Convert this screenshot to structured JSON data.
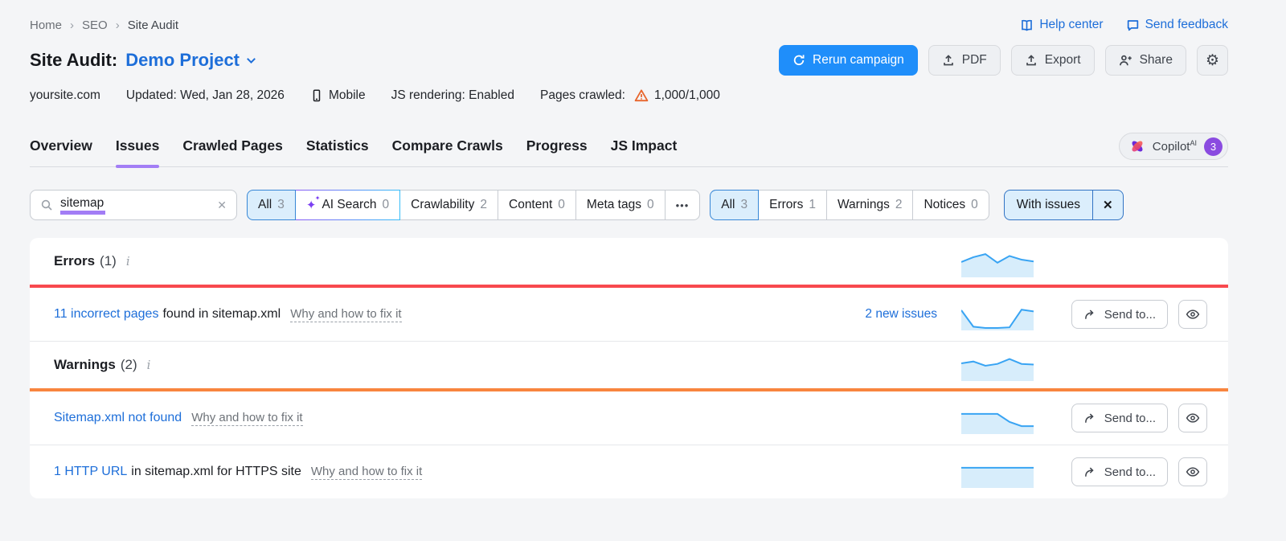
{
  "colors": {
    "accent_blue": "#1f8efa",
    "link_blue": "#1d6ed9",
    "purple_marker": "#a27df5",
    "badge_purple": "#8a4be0",
    "red_bar": "#f8494e",
    "orange_bar": "#f8853f",
    "spark_line": "#39a4f3",
    "spark_fill": "#d7edfb",
    "selected_bg": "#dbeefc",
    "selected_border": "#3787d6",
    "warning_orange": "#e8662d"
  },
  "breadcrumb": {
    "items": [
      "Home",
      "SEO",
      "Site Audit"
    ],
    "separator": "›"
  },
  "top_links": {
    "help_center": "Help center",
    "send_feedback": "Send feedback"
  },
  "header": {
    "title": "Site Audit:",
    "project": "Demo Project",
    "rerun_label": "Rerun campaign",
    "pdf_label": "PDF",
    "export_label": "Export",
    "share_label": "Share",
    "gear_icon": "⚙"
  },
  "meta": {
    "domain": "yoursite.com",
    "updated": "Updated: Wed, Jan 28, 2026",
    "device": "Mobile",
    "js_rendering": "JS rendering: Enabled",
    "pages_crawled_label": "Pages crawled:",
    "pages_crawled_value": "1,000/1,000"
  },
  "tabs": {
    "items": [
      "Overview",
      "Issues",
      "Crawled Pages",
      "Statistics",
      "Compare Crawls",
      "Progress",
      "JS Impact"
    ],
    "active": "Issues",
    "copilot": {
      "label": "Copilot",
      "sup": "AI",
      "badge": "3"
    }
  },
  "filters": {
    "search_value": "sitemap",
    "clear_icon": "✕",
    "category": [
      {
        "label": "All",
        "count": "3",
        "selected": true
      },
      {
        "label": "AI Search",
        "count": "0",
        "ai": true
      },
      {
        "label": "Crawlability",
        "count": "2"
      },
      {
        "label": "Content",
        "count": "0"
      },
      {
        "label": "Meta tags",
        "count": "0"
      }
    ],
    "more": "•••",
    "severity": [
      {
        "label": "All",
        "count": "3",
        "selected": true
      },
      {
        "label": "Errors",
        "count": "1"
      },
      {
        "label": "Warnings",
        "count": "2"
      },
      {
        "label": "Notices",
        "count": "0"
      }
    ],
    "with_issues": {
      "label": "With issues",
      "close": "✕"
    },
    "sparkle_icon": "✦"
  },
  "issues": {
    "sections": [
      {
        "title": "Errors",
        "count": "(1)",
        "info": "i",
        "bar_color": "#f8494e",
        "sparkline": [
          50,
          66,
          76,
          48,
          70,
          58,
          52
        ],
        "rows": [
          {
            "link": "11 incorrect pages",
            "rest": "found in sitemap.xml",
            "why": "Why and how to fix it",
            "new_issues": "2 new issues",
            "sparkline": [
              66,
              12,
              8,
              8,
              10,
              68,
              62
            ]
          }
        ]
      },
      {
        "title": "Warnings",
        "count": "(2)",
        "info": "i",
        "bar_color": "#f8853f",
        "sparkline": [
          58,
          64,
          50,
          56,
          72,
          56,
          54
        ],
        "rows": [
          {
            "link": "Sitemap.xml not found",
            "rest": "",
            "why": "Why and how to fix it",
            "sparkline": [
              66,
              66,
              66,
              66,
              40,
              26,
              26
            ]
          },
          {
            "link": "1 HTTP URL",
            "rest": "in sitemap.xml for HTTPS site",
            "why": "Why and how to fix it",
            "sparkline": [
              66,
              66,
              66,
              66,
              66,
              66,
              66
            ]
          }
        ]
      }
    ]
  },
  "ui": {
    "send_label": "Send to..."
  }
}
